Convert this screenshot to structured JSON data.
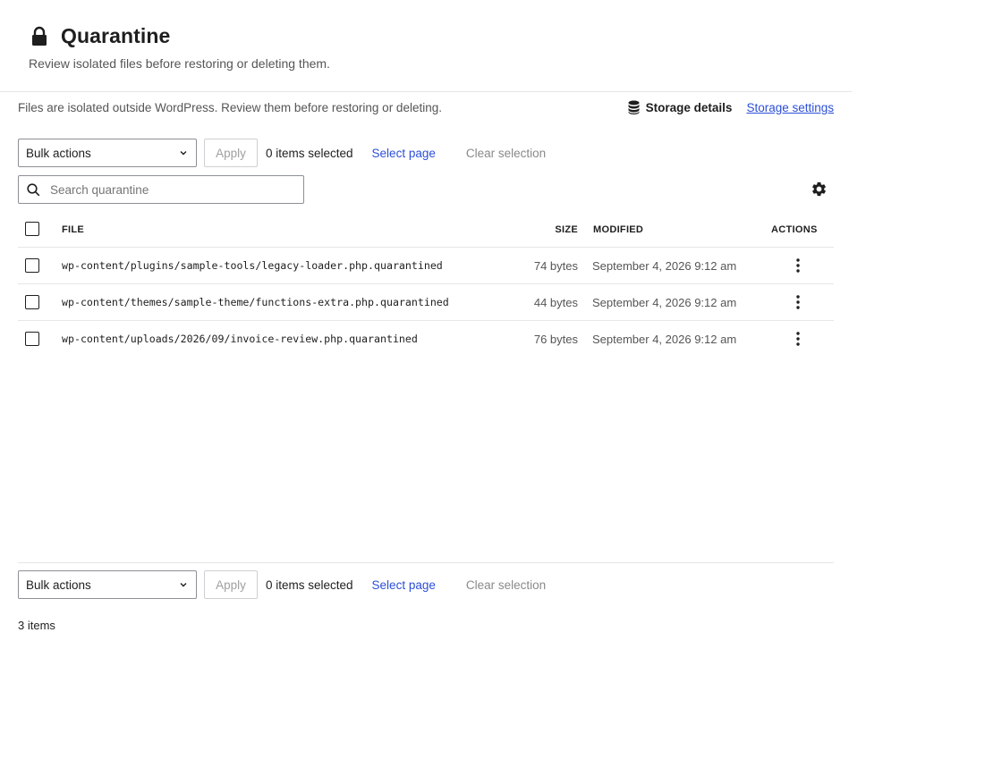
{
  "header": {
    "title": "Quarantine",
    "subtitle": "Review isolated files before restoring or deleting them."
  },
  "notice": {
    "text": "Files are isolated outside WordPress. Review them before restoring or deleting.",
    "storage_details": "Storage details",
    "storage_settings": "Storage settings"
  },
  "bulk_top": {
    "select": "Bulk actions",
    "apply": "Apply",
    "count": "0 items selected",
    "select_page": "Select page",
    "clear_selection": "Clear selection"
  },
  "search": {
    "placeholder": "Search quarantine",
    "value": ""
  },
  "table": {
    "columns": {
      "file": "FILE",
      "size": "SIZE",
      "modified": "MODIFIED",
      "actions": "ACTIONS"
    },
    "rows": [
      {
        "file": "wp-content/plugins/sample-tools/legacy-loader.php.quarantined",
        "size": "74 bytes",
        "modified": "September 4, 2026 9:12 am"
      },
      {
        "file": "wp-content/themes/sample-theme/functions-extra.php.quarantined",
        "size": "44 bytes",
        "modified": "September 4, 2026 9:12 am"
      },
      {
        "file": "wp-content/uploads/2026/09/invoice-review.php.quarantined",
        "size": "76 bytes",
        "modified": "September 4, 2026 9:12 am"
      }
    ]
  },
  "bulk_bottom": {
    "select": "Bulk actions",
    "apply": "Apply",
    "count": "0 items selected",
    "select_page": "Select page",
    "clear_selection": "Clear selection"
  },
  "footer": {
    "total": "3 items"
  },
  "colors": {
    "link": "#2c4fd8",
    "text": "#1e1e1e",
    "muted": "#555555",
    "border": "#e6e6e6"
  },
  "icons": [
    "lock-icon",
    "database-icon",
    "chevron-down-icon",
    "search-icon",
    "gear-icon",
    "more-vertical-icon"
  ]
}
